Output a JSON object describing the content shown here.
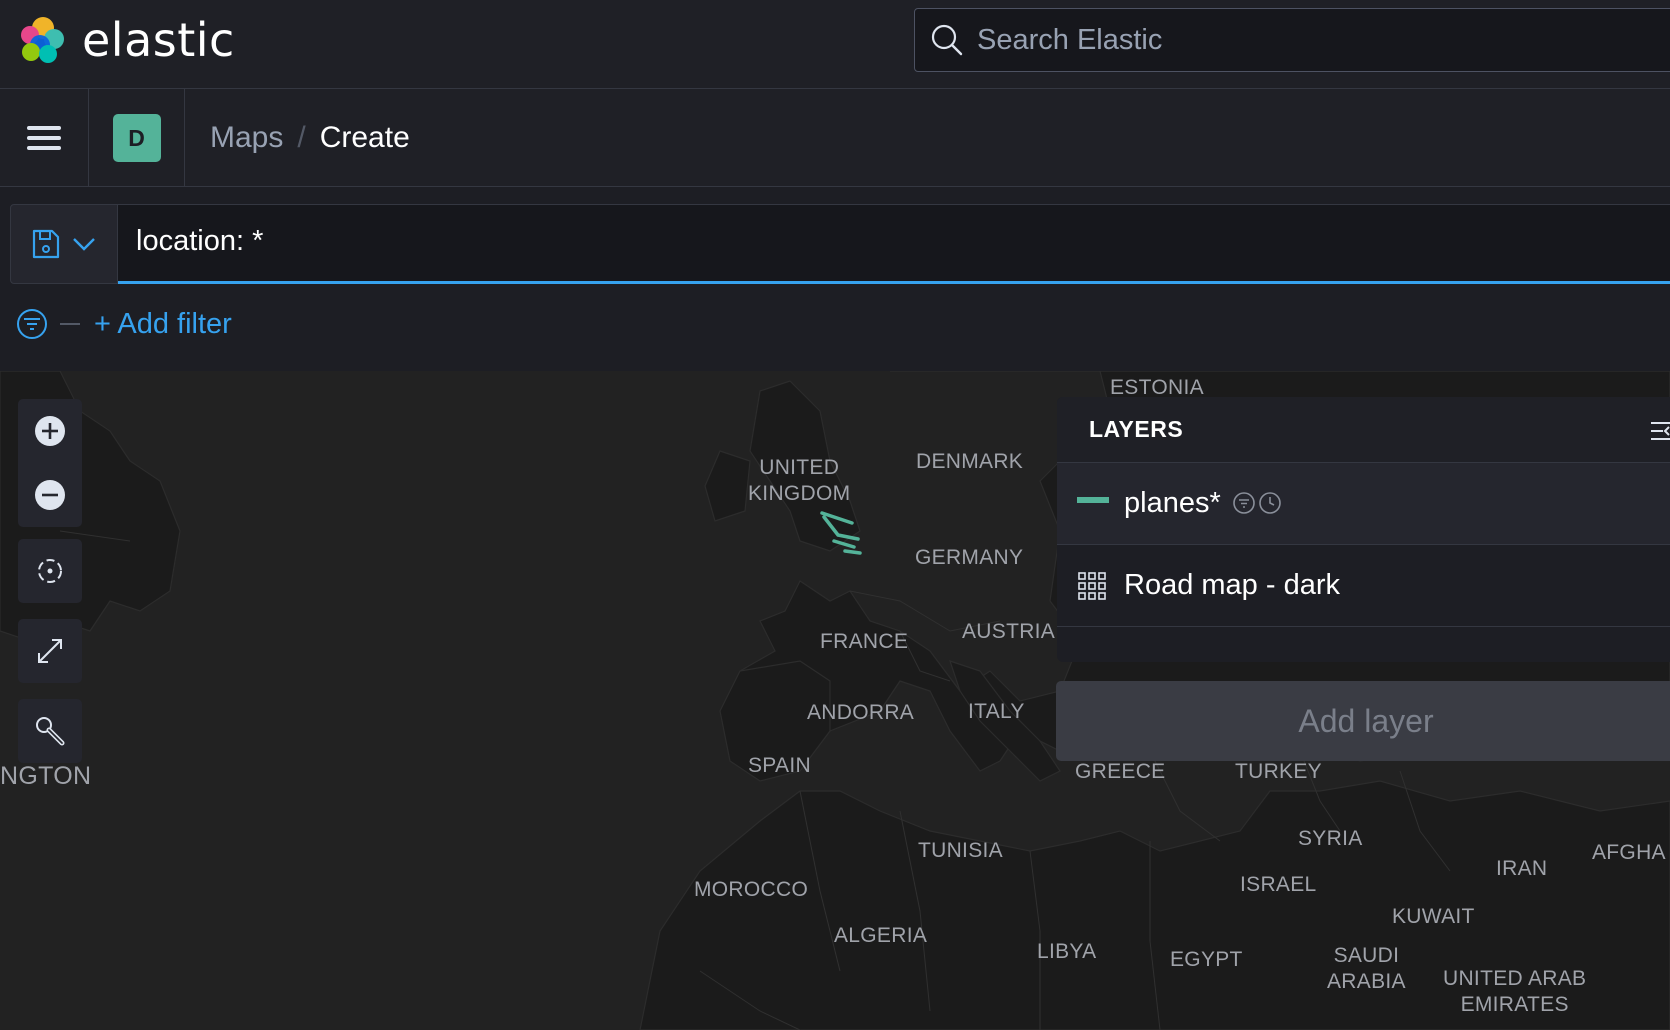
{
  "header": {
    "logo_text": "elastic",
    "search_placeholder": "Search Elastic"
  },
  "nav": {
    "space_initial": "D",
    "breadcrumbs": [
      {
        "label": "Maps"
      },
      {
        "label": "Create"
      }
    ]
  },
  "query": {
    "value": "location: *",
    "add_filter_label": "+ Add filter"
  },
  "map": {
    "labels": [
      {
        "text": "ESTONIA"
      },
      {
        "text": "UNITED\nKINGDOM"
      },
      {
        "text": "DENMARK"
      },
      {
        "text": "GERMANY"
      },
      {
        "text": "FRANCE"
      },
      {
        "text": "AUSTRIA"
      },
      {
        "text": "ANDORRA"
      },
      {
        "text": "ITALY"
      },
      {
        "text": "SPAIN"
      },
      {
        "text": "NGTON"
      },
      {
        "text": "GREECE"
      },
      {
        "text": "TURKEY"
      },
      {
        "text": "SYRIA"
      },
      {
        "text": "TUNISIA"
      },
      {
        "text": "MOROCCO"
      },
      {
        "text": "ISRAEL"
      },
      {
        "text": "IRAN"
      },
      {
        "text": "AFGHA"
      },
      {
        "text": "KUWAIT"
      },
      {
        "text": "ALGERIA"
      },
      {
        "text": "LIBYA"
      },
      {
        "text": "EGYPT"
      },
      {
        "text": "SAUDI\nARABIA"
      },
      {
        "text": "UNITED ARAB\nEMIRATES"
      }
    ]
  },
  "layers": {
    "title": "LAYERS",
    "items": [
      {
        "name": "planes*",
        "icon": "color-swatch",
        "color": "#54b399"
      },
      {
        "name": "Road map - dark",
        "icon": "grid-icon"
      }
    ],
    "add_label": "Add layer"
  },
  "colors": {
    "accent": "#36a2ef",
    "layer_color": "#54b399"
  }
}
